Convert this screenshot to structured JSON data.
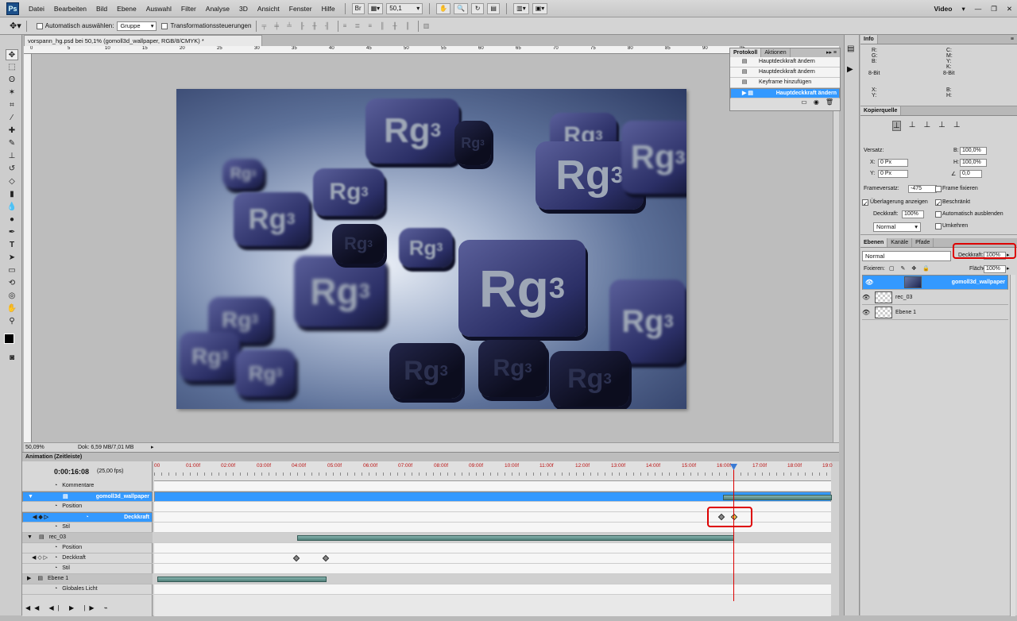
{
  "menubar": {
    "logo": "Ps",
    "items": [
      "Datei",
      "Bearbeiten",
      "Bild",
      "Ebene",
      "Auswahl",
      "Filter",
      "Analyse",
      "3D",
      "Ansicht",
      "Fenster",
      "Hilfe"
    ],
    "zoom": "50,1",
    "workspace": "Video"
  },
  "options": {
    "auto_select": "Automatisch auswählen:",
    "auto_select_value": "Gruppe",
    "transform": "Transformationssteuerungen"
  },
  "document": {
    "tab": "vorspann_hg.psd bei 50,1% (gomoll3d_wallpaper, RGB/8/CMYK) *",
    "zoom": "50,09%",
    "doc_size": "Dok: 6,59 MB/7,01 MB",
    "ruler_h": [
      "0",
      "5",
      "10",
      "15",
      "20",
      "25",
      "30",
      "35",
      "40",
      "45",
      "50",
      "55",
      "60",
      "65",
      "70",
      "75",
      "80",
      "85",
      "90",
      "95"
    ]
  },
  "image": {
    "cube_text": "Rg",
    "cube_sup": "3"
  },
  "history": {
    "tabs": [
      "Protokoll",
      "Aktionen"
    ],
    "rows": [
      "Hauptdeckkraft ändern",
      "Hauptdeckkraft ändern",
      "Keyframe hinzufügen",
      "Hauptdeckkraft ändern"
    ],
    "selected": 3
  },
  "info": {
    "title": "Info",
    "rgb": [
      "R:",
      "G:",
      "B:"
    ],
    "cmyk": [
      "C:",
      "M:",
      "Y:",
      "K:"
    ],
    "bit": "8-Bit",
    "xy": [
      "X:",
      "Y:"
    ],
    "bh": [
      "B:",
      "H:"
    ]
  },
  "clone": {
    "title": "Kopierquelle",
    "versatz": "Versatz:",
    "x": "X:",
    "x_val": "0 Px",
    "y": "Y:",
    "y_val": "0 Px",
    "b": "B:",
    "b_val": "100,0%",
    "h": "H:",
    "h_val": "100,0%",
    "angle_val": "0,0",
    "frame_label": "Frameversatz:",
    "frame_val": "-475",
    "frame_fix": "Frame fixieren",
    "overlay": "Überlagerung anzeigen",
    "limited": "Beschränkt",
    "opacity_label": "Deckkraft:",
    "opacity_val": "100%",
    "auto_hide": "Automatisch ausblenden",
    "mode": "Normal",
    "invert": "Umkehren"
  },
  "layers": {
    "tabs": [
      "Ebenen",
      "Kanäle",
      "Pfade"
    ],
    "mode": "Normal",
    "opacity_label": "Deckkraft:",
    "opacity_val": "100%",
    "lock_label": "Fixieren:",
    "fill_label": "Fläche:",
    "fill_val": "100%",
    "items": [
      "gomoll3d_wallpaper",
      "rec_03",
      "Ebene 1"
    ]
  },
  "animation": {
    "title": "Animation (Zeitleiste)",
    "timecode": "0:00:16:08",
    "fps": "(25,00 fps)",
    "ticks": [
      "00",
      "01:00f",
      "02:00f",
      "03:00f",
      "04:00f",
      "05:00f",
      "06:00f",
      "07:00f",
      "08:00f",
      "09:00f",
      "10:00f",
      "11:00f",
      "12:00f",
      "13:00f",
      "14:00f",
      "15:00f",
      "16:00f",
      "17:00f",
      "18:00f",
      "19:0"
    ],
    "rows": [
      "Kommentare",
      "gomoll3d_wallpaper",
      "Position",
      "Deckkraft",
      "Stil",
      "rec_03",
      "Position",
      "Deckkraft",
      "Stil",
      "Ebene 1",
      "Globales Licht"
    ]
  }
}
